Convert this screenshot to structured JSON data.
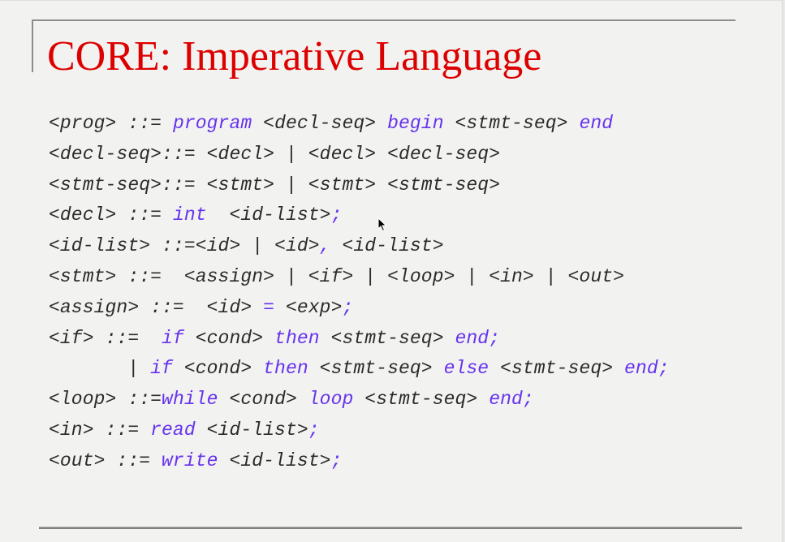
{
  "slide": {
    "title": "CORE: Imperative Language",
    "colors": {
      "title": "#dd0000",
      "keyword": "#6633ee",
      "text": "#2b2b2b",
      "background": "#f2f2f0",
      "rule": "#8c8c8c"
    }
  },
  "grammar": [
    {
      "name": "prog",
      "tokens": [
        {
          "t": "nt",
          "v": "<prog> "
        },
        {
          "t": "op",
          "v": "::= "
        },
        {
          "t": "kw",
          "v": "program"
        },
        {
          "t": "nt",
          "v": " <decl-seq> "
        },
        {
          "t": "kw",
          "v": "begin"
        },
        {
          "t": "nt",
          "v": " <stmt-seq> "
        },
        {
          "t": "kw",
          "v": "end"
        }
      ]
    },
    {
      "name": "decl-seq",
      "tokens": [
        {
          "t": "nt",
          "v": "<decl-seq>"
        },
        {
          "t": "op",
          "v": "::= "
        },
        {
          "t": "nt",
          "v": "<decl> | <decl> <decl-seq>"
        }
      ]
    },
    {
      "name": "stmt-seq",
      "tokens": [
        {
          "t": "nt",
          "v": "<stmt-seq>"
        },
        {
          "t": "op",
          "v": "::= "
        },
        {
          "t": "nt",
          "v": "<stmt> | <stmt> <stmt-seq>"
        }
      ]
    },
    {
      "name": "decl",
      "tokens": [
        {
          "t": "nt",
          "v": "<decl> "
        },
        {
          "t": "op",
          "v": "::= "
        },
        {
          "t": "kw",
          "v": "int"
        },
        {
          "t": "nt",
          "v": "  <id-list>"
        },
        {
          "t": "kw",
          "v": ";"
        }
      ]
    },
    {
      "name": "id-list",
      "tokens": [
        {
          "t": "nt",
          "v": "<id-list> "
        },
        {
          "t": "op",
          "v": "::="
        },
        {
          "t": "nt",
          "v": "<id> | <id>"
        },
        {
          "t": "kw",
          "v": ","
        },
        {
          "t": "nt",
          "v": " <id-list>"
        }
      ]
    },
    {
      "name": "stmt",
      "tokens": [
        {
          "t": "nt",
          "v": "<stmt> "
        },
        {
          "t": "op",
          "v": "::= "
        },
        {
          "t": "nt",
          "v": " <assign> | <if> | <loop> | <in> | <out>"
        }
      ]
    },
    {
      "name": "assign",
      "tokens": [
        {
          "t": "nt",
          "v": "<assign> "
        },
        {
          "t": "op",
          "v": "::= "
        },
        {
          "t": "nt",
          "v": " <id> "
        },
        {
          "t": "kw",
          "v": "="
        },
        {
          "t": "nt",
          "v": " <exp>"
        },
        {
          "t": "kw",
          "v": ";"
        }
      ]
    },
    {
      "name": "if",
      "tokens": [
        {
          "t": "nt",
          "v": "<if> "
        },
        {
          "t": "op",
          "v": "::= "
        },
        {
          "t": "nt",
          "v": " "
        },
        {
          "t": "kw",
          "v": "if"
        },
        {
          "t": "nt",
          "v": " <cond> "
        },
        {
          "t": "kw",
          "v": "then"
        },
        {
          "t": "nt",
          "v": " <stmt-seq> "
        },
        {
          "t": "kw",
          "v": "end;"
        }
      ]
    },
    {
      "name": "if-else",
      "tokens": [
        {
          "t": "nt",
          "v": "       | "
        },
        {
          "t": "kw",
          "v": "if"
        },
        {
          "t": "nt",
          "v": " <cond> "
        },
        {
          "t": "kw",
          "v": "then"
        },
        {
          "t": "nt",
          "v": " <stmt-seq> "
        },
        {
          "t": "kw",
          "v": "else"
        },
        {
          "t": "nt",
          "v": " <stmt-seq> "
        },
        {
          "t": "kw",
          "v": "end;"
        }
      ]
    },
    {
      "name": "loop",
      "tokens": [
        {
          "t": "nt",
          "v": "<loop> "
        },
        {
          "t": "op",
          "v": "::="
        },
        {
          "t": "kw",
          "v": "while"
        },
        {
          "t": "nt",
          "v": " <cond> "
        },
        {
          "t": "kw",
          "v": "loop"
        },
        {
          "t": "nt",
          "v": " <stmt-seq> "
        },
        {
          "t": "kw",
          "v": "end;"
        }
      ]
    },
    {
      "name": "in",
      "tokens": [
        {
          "t": "nt",
          "v": "<in> "
        },
        {
          "t": "op",
          "v": "::= "
        },
        {
          "t": "kw",
          "v": "read"
        },
        {
          "t": "nt",
          "v": " <id-list>"
        },
        {
          "t": "kw",
          "v": ";"
        }
      ]
    },
    {
      "name": "out",
      "tokens": [
        {
          "t": "nt",
          "v": "<out> "
        },
        {
          "t": "op",
          "v": "::= "
        },
        {
          "t": "kw",
          "v": "write"
        },
        {
          "t": "nt",
          "v": " <id-list>"
        },
        {
          "t": "kw",
          "v": ";"
        }
      ]
    }
  ],
  "cursor": {
    "icon": "mouse-pointer-icon"
  }
}
